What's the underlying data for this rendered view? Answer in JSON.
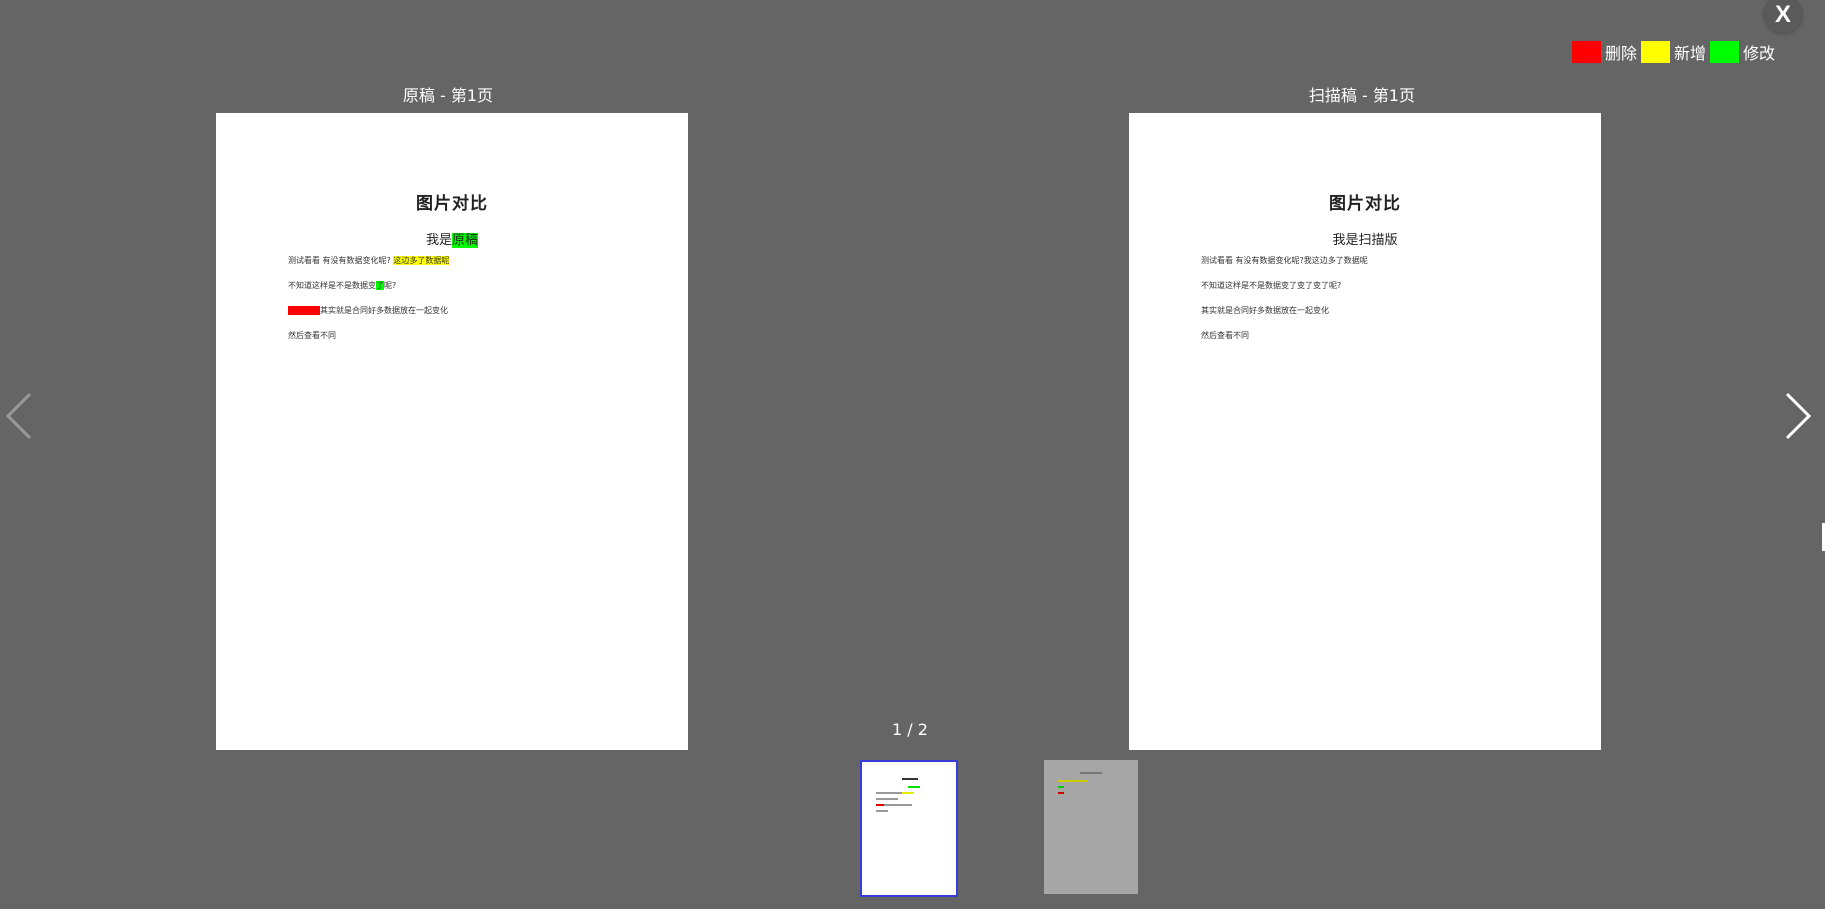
{
  "close_label": "X",
  "legend": [
    {
      "label": "删除",
      "color": "#ff0000"
    },
    {
      "label": "新增",
      "color": "#ffff00"
    },
    {
      "label": "修改",
      "color": "#00ff00"
    }
  ],
  "left": {
    "caption": "原稿 - 第1页",
    "title": "图片对比",
    "subtitle_prefix": "我是",
    "subtitle_mod": "原稿",
    "line1_text": "测试看看  有没有数据变化呢?",
    "line1_add": "这边多了数据呢",
    "line2_prefix": "不知道这样是不是数据变",
    "line2_mod": "了",
    "line2_suffix": "呢?",
    "line3_del": "删除数据",
    "line3_text": "其实就是合同好多数据放在一起变化",
    "line4_text": "然后查看不同"
  },
  "right": {
    "caption": "扫描稿 - 第1页",
    "title": "图片对比",
    "subtitle": "我是扫描版",
    "line1": "测试看看  有没有数据变化呢?我这边多了数据呢",
    "line2": "不知道这样是不是数据变了变了变了呢?",
    "line3": "其实就是合同好多数据放在一起变化",
    "line4": "然后查看不同"
  },
  "pager": {
    "text": "1 / 2"
  },
  "thumbnails": [
    {
      "name": "page-1",
      "selected": true
    },
    {
      "name": "page-2",
      "selected": false
    }
  ],
  "icons": {
    "prev": "chevron-left-icon",
    "next": "chevron-right-icon",
    "close": "close-icon"
  }
}
